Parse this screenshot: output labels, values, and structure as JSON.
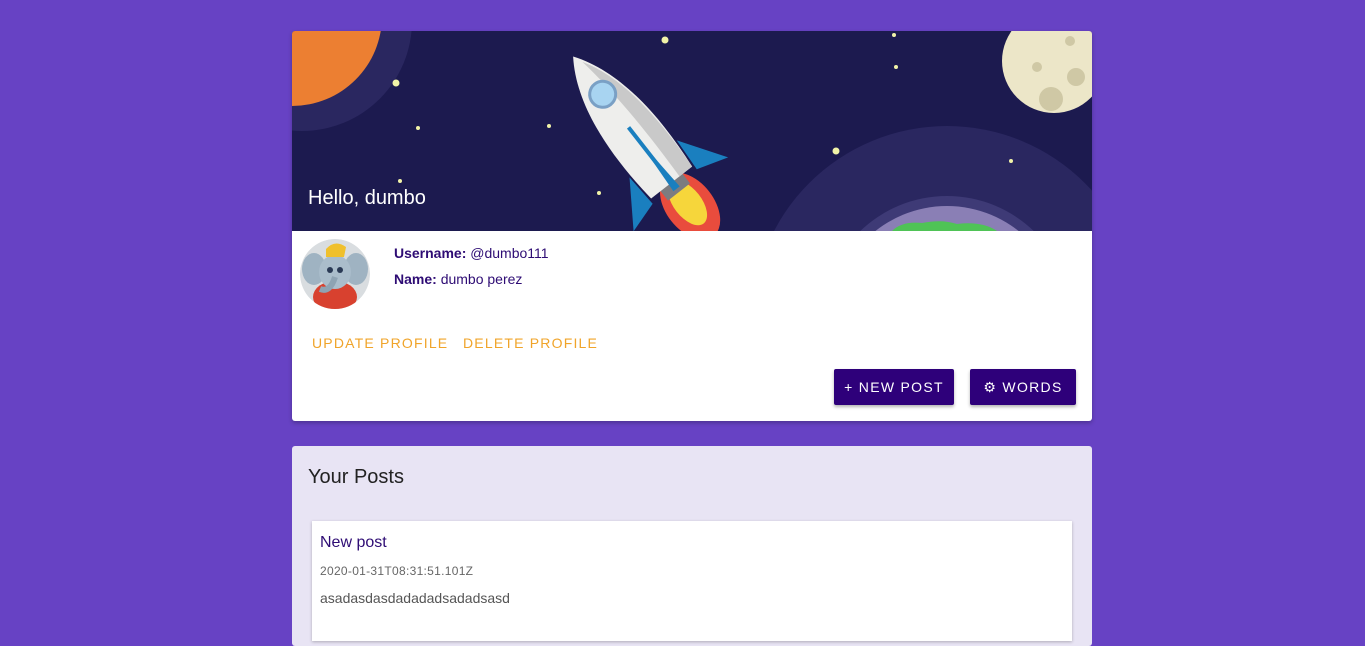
{
  "profile": {
    "greeting": "Hello, dumbo",
    "username_label": "Username:",
    "username_value": "@dumbo111",
    "name_label": "Name:",
    "name_value": "dumbo perez"
  },
  "actions": {
    "update_label": "UPDATE PROFILE",
    "delete_label": "DELETE PROFILE",
    "new_post_label": "+ NEW POST",
    "words_label": "⚙ WORDS"
  },
  "posts": {
    "heading": "Your Posts",
    "items": [
      {
        "title": "New post",
        "date": "2020-01-31T08:31:51.101Z",
        "body": "asadasdasdadadadsadadsasd"
      }
    ]
  },
  "colors": {
    "page_bg": "#6742c4",
    "banner_bg": "#1c1a4f",
    "accent": "#f0a42a",
    "primary_button": "#2e007a"
  }
}
